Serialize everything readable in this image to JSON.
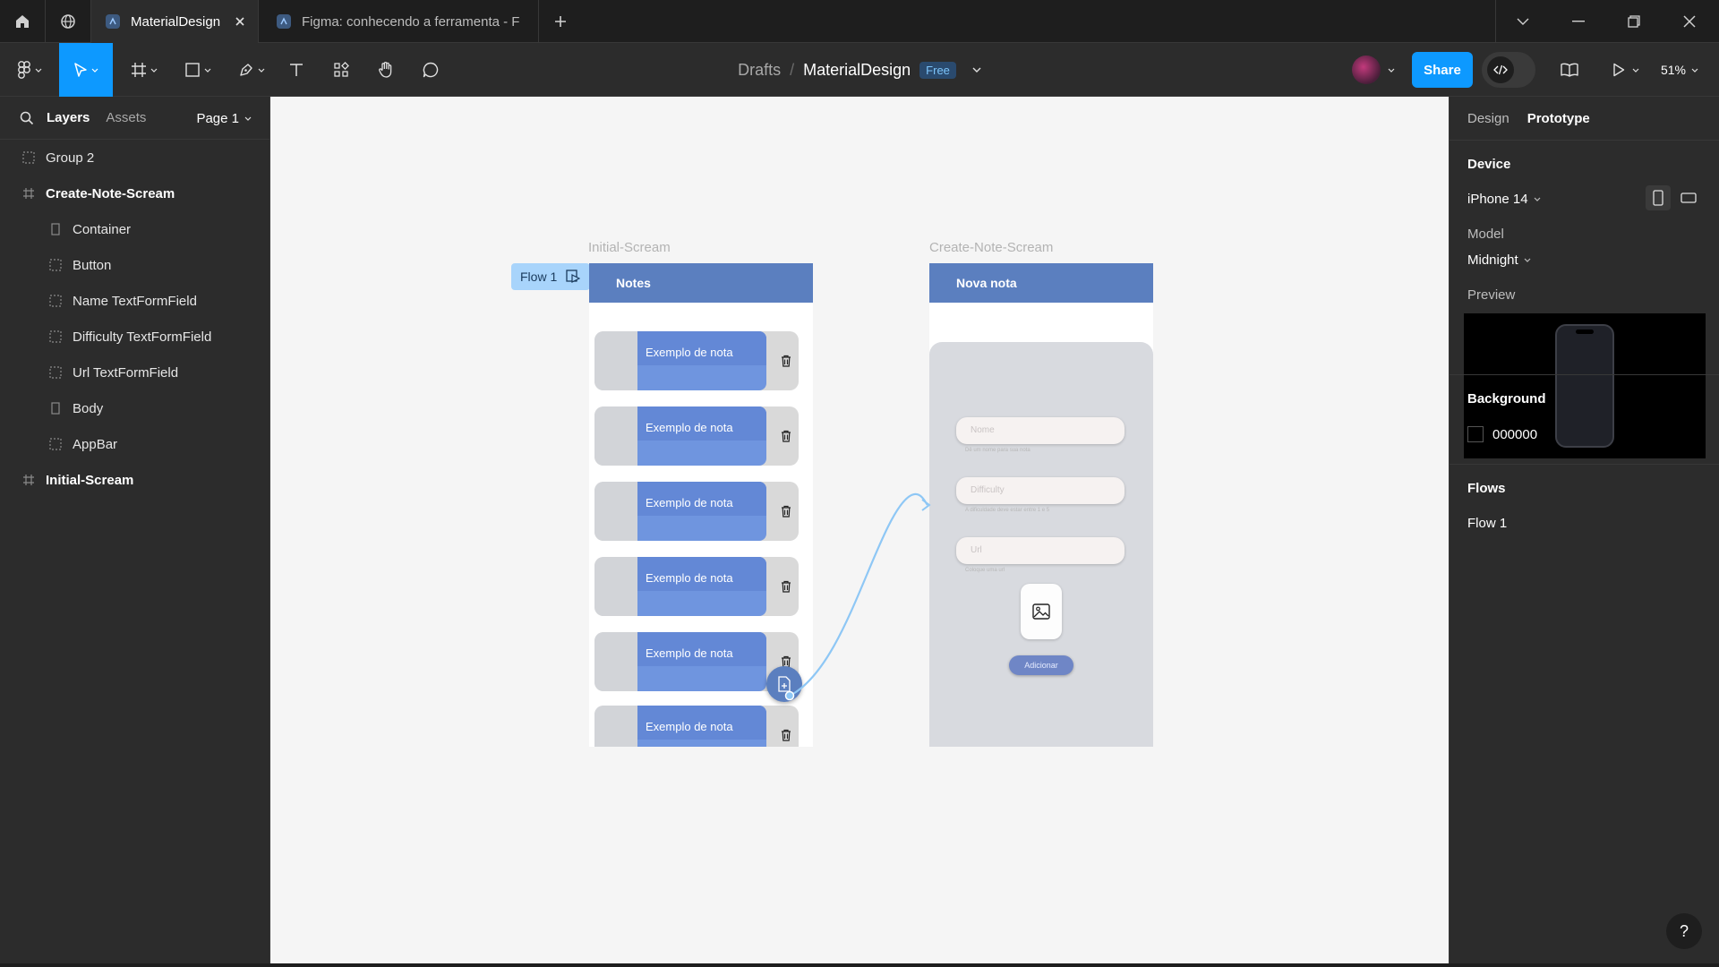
{
  "window": {
    "tabs": [
      {
        "label": "MaterialDesign",
        "icon": "figma-file-icon"
      },
      {
        "label": "Figma: conhecendo a ferramenta - F",
        "icon": "figma-file-icon"
      }
    ]
  },
  "toolbar": {
    "breadcrumb_parent": "Drafts",
    "breadcrumb_sep": "/",
    "file_name": "MaterialDesign",
    "plan_badge": "Free",
    "share_label": "Share",
    "zoom": "51%"
  },
  "left_panel": {
    "tabs": [
      "Layers",
      "Assets"
    ],
    "page": "Page 1",
    "layers": [
      {
        "label": "Group 2",
        "icon": "group-icon"
      },
      {
        "label": "Create-Note-Scream",
        "icon": "frame-icon"
      },
      {
        "label": "Container",
        "icon": "rectangle-icon"
      },
      {
        "label": "Button",
        "icon": "group-icon"
      },
      {
        "label": "Name TextFormField",
        "icon": "group-icon"
      },
      {
        "label": "Difficulty TextFormField",
        "icon": "group-icon"
      },
      {
        "label": "Url TextFormField",
        "icon": "group-icon"
      },
      {
        "label": "Body",
        "icon": "rectangle-icon"
      },
      {
        "label": "AppBar",
        "icon": "group-icon"
      },
      {
        "label": "Initial-Scream",
        "icon": "frame-icon"
      }
    ]
  },
  "canvas": {
    "flow_badge": "Flow 1",
    "initial": {
      "frame_label": "Initial-Scream",
      "appbar_title": "Notes",
      "notes": [
        "Exemplo de nota",
        "Exemplo de nota",
        "Exemplo de nota",
        "Exemplo de nota",
        "Exemplo de nota",
        "Exemplo de nota"
      ]
    },
    "create": {
      "frame_label": "Create-Note-Scream",
      "appbar_title": "Nova nota",
      "fields": [
        {
          "placeholder": "Nome",
          "help": "Dê um nome para sua nota"
        },
        {
          "placeholder": "Difficulty",
          "help": "A dificuldade deve estar entre 1 e 5"
        },
        {
          "placeholder": "Url",
          "help": "Coloque uma url"
        }
      ],
      "add_button": "Adicionar"
    }
  },
  "right_panel": {
    "tabs": [
      "Design",
      "Prototype"
    ],
    "device_heading": "Device",
    "device_value": "iPhone 14",
    "model_label": "Model",
    "model_value": "Midnight",
    "preview_label": "Preview",
    "background_heading": "Background",
    "background_value": "000000",
    "flows_heading": "Flows",
    "flows": [
      "Flow 1"
    ]
  },
  "help_label": "?",
  "colors": {
    "accent": "#0d99ff",
    "appbar": "#5b7fbf",
    "note_card": "#6f95df",
    "connector": "#8ec7f5"
  }
}
